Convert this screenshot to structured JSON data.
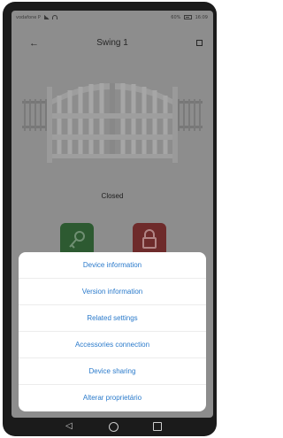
{
  "status_bar": {
    "carrier": "vodafone P",
    "right_text": "60%",
    "time": "16:09"
  },
  "header": {
    "title": "Swing 1"
  },
  "gate": {
    "status": "Closed"
  },
  "actions": {
    "open_icon": "key-icon",
    "close_icon": "lock-icon",
    "open_color": "#2d5a31",
    "close_color": "#6e2b2b"
  },
  "menu": {
    "items": [
      "Device information",
      "Version information",
      "Related settings",
      "Accessories connection",
      "Device sharing",
      "Alterar proprietário"
    ]
  }
}
